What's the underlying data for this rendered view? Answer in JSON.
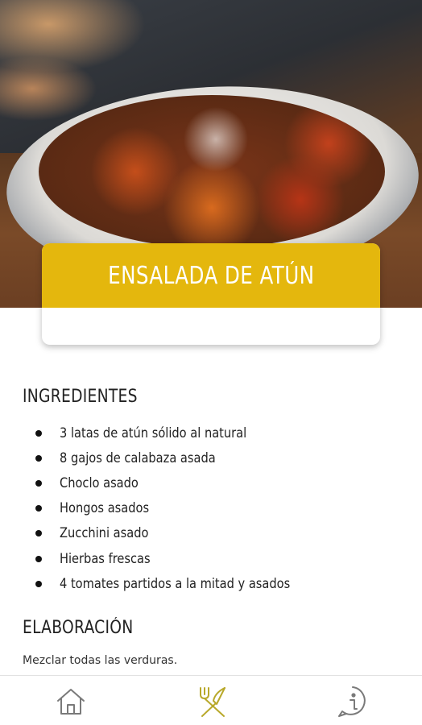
{
  "recipe": {
    "title": "ENSALADA DE ATÚN"
  },
  "ingredients": {
    "heading": "INGREDIENTES",
    "items": [
      "3 latas de atún sólido al natural",
      "8 gajos de calabaza asada",
      "Choclo asado",
      "Hongos asados",
      "Zucchini asado",
      "Hierbas frescas",
      "4 tomates partidos a la mitad y asados"
    ]
  },
  "elaboration": {
    "heading": "ELABORACIÓN",
    "text": "Mezclar todas las verduras."
  },
  "nav": {
    "items": [
      {
        "icon": "home-icon",
        "active": false
      },
      {
        "icon": "fork-knife-icon",
        "active": true
      },
      {
        "icon": "info-icon",
        "active": false
      }
    ],
    "active_color": "#b8a82a",
    "inactive_color": "#7a7a7a"
  },
  "colors": {
    "accent": "#e4b70d"
  }
}
